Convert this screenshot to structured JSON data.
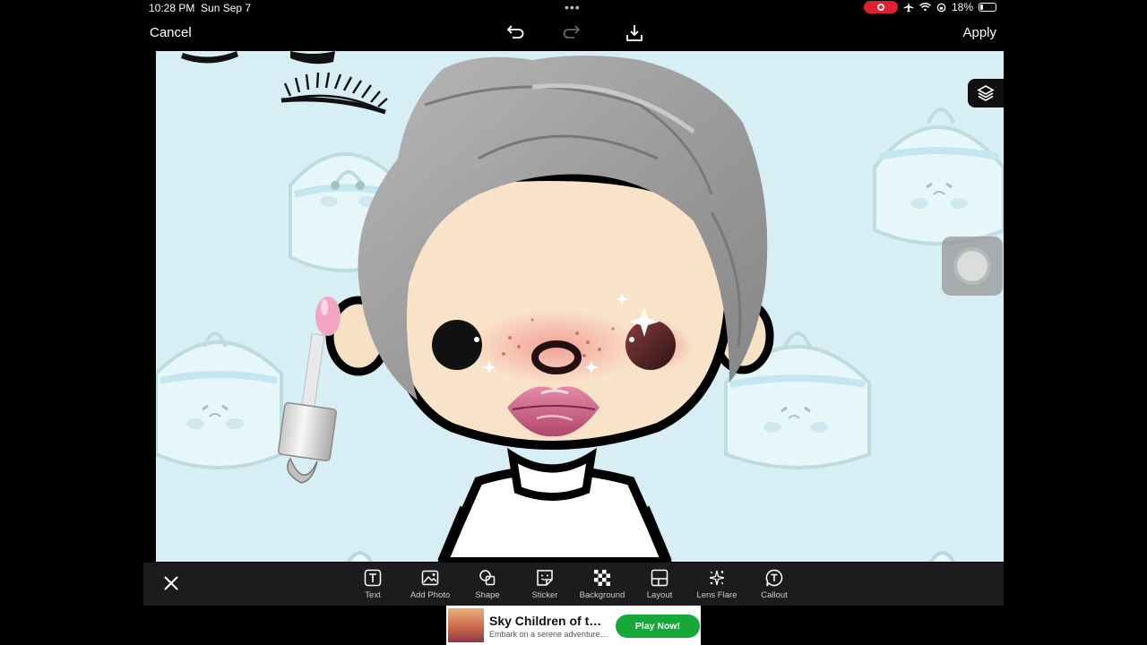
{
  "status_bar": {
    "time": "10:28 PM",
    "date": "Sun Sep 7",
    "battery": "18%"
  },
  "top_toolbar": {
    "cancel_label": "Cancel",
    "apply_label": "Apply"
  },
  "bottom_toolbar": {
    "tools": [
      {
        "label": "Text",
        "icon": "text-icon"
      },
      {
        "label": "Add Photo",
        "icon": "add-photo-icon"
      },
      {
        "label": "Shape",
        "icon": "shape-icon"
      },
      {
        "label": "Sticker",
        "icon": "sticker-icon"
      },
      {
        "label": "Background",
        "icon": "background-icon"
      },
      {
        "label": "Layout",
        "icon": "layout-icon"
      },
      {
        "label": "Lens Flare",
        "icon": "lens-flare-icon"
      },
      {
        "label": "Callout",
        "icon": "callout-icon"
      }
    ]
  },
  "ad": {
    "title": "Sky Children of t…",
    "subtitle": "Embark on a serene adventure…",
    "button_label": "Play Now!"
  },
  "colors": {
    "canvas_bg": "#d7eff4",
    "toolbar_bg": "#1c1c1e",
    "ad_button": "#17a83a",
    "record": "#e0202a"
  }
}
